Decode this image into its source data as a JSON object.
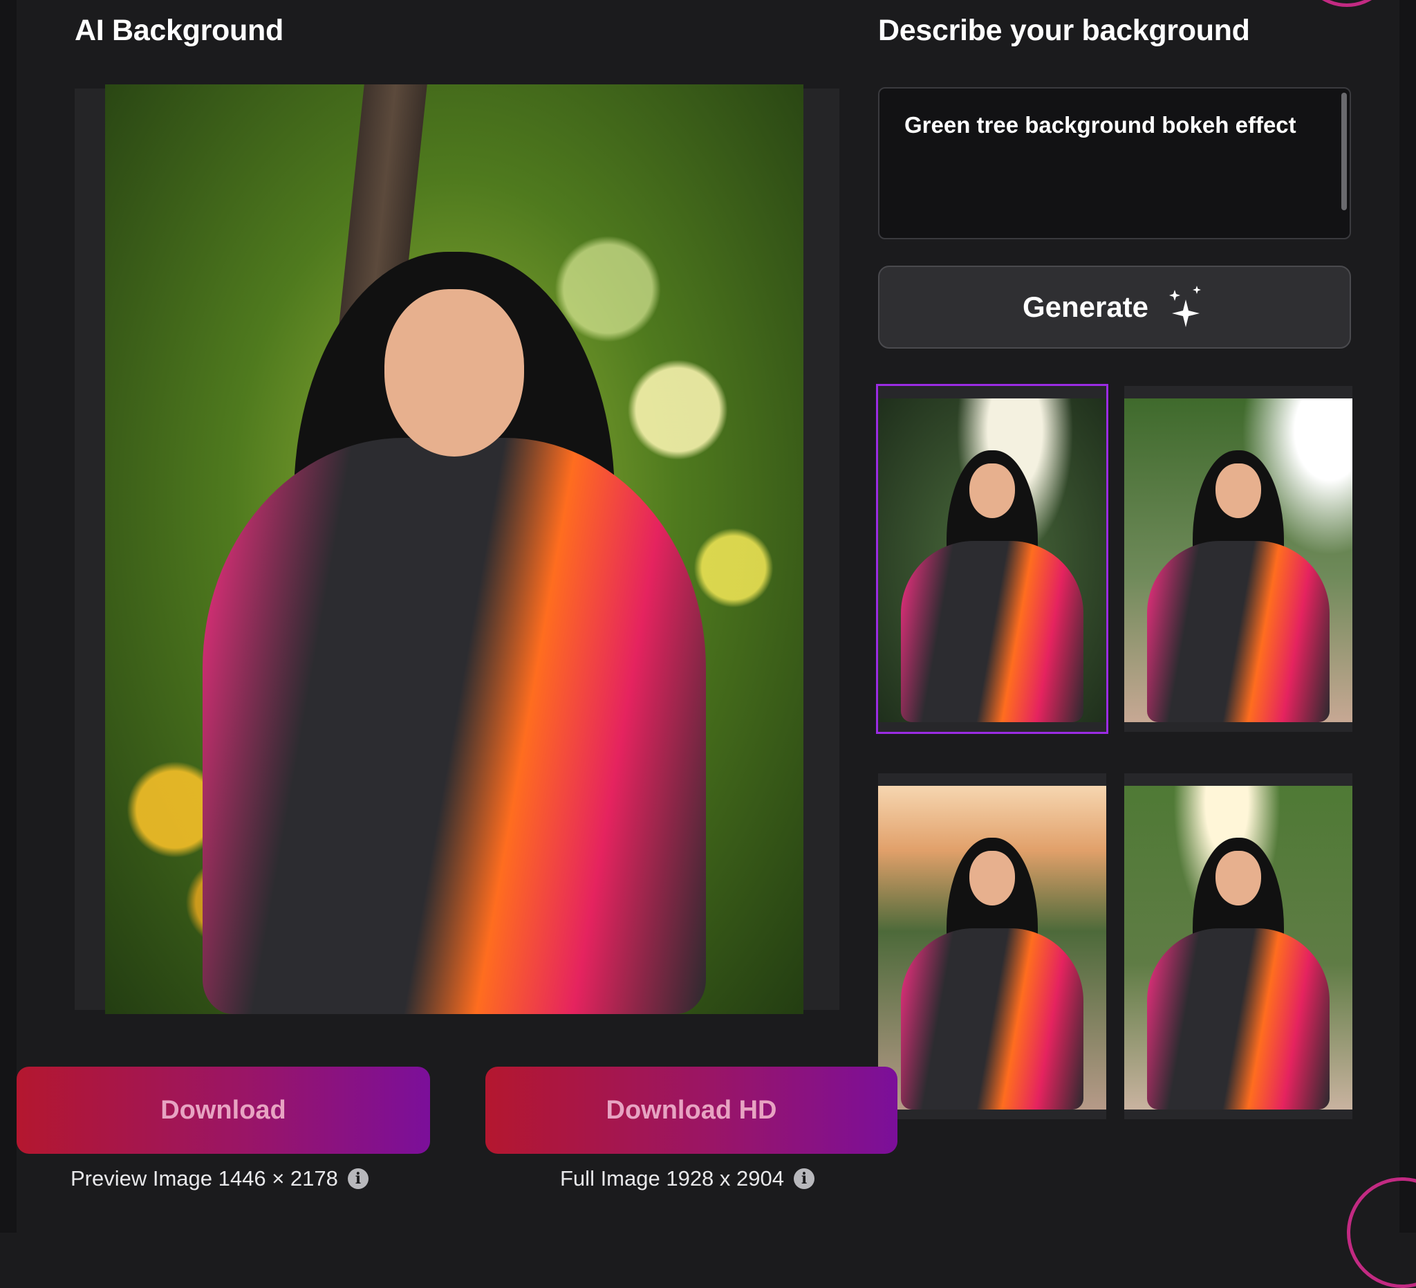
{
  "left_panel": {
    "title": "AI Background",
    "download_label": "Download",
    "download_hd_label": "Download HD",
    "preview_info": "Preview Image 1446 × 2178",
    "full_info": "Full Image 1928 x 2904",
    "info_icon": "i"
  },
  "right_panel": {
    "title": "Describe your background",
    "prompt_value": "Green tree background bokeh effect",
    "generate_label": "Generate",
    "thumbnails_selected_index": 0
  },
  "colors": {
    "background": "#1b1b1d",
    "accent_purple": "#9b2ce3",
    "download_gradient_start": "#b4172f",
    "download_gradient_end": "#7b0f9a"
  },
  "icons": {
    "generate": "sparkle-icon",
    "info": "info-icon"
  }
}
